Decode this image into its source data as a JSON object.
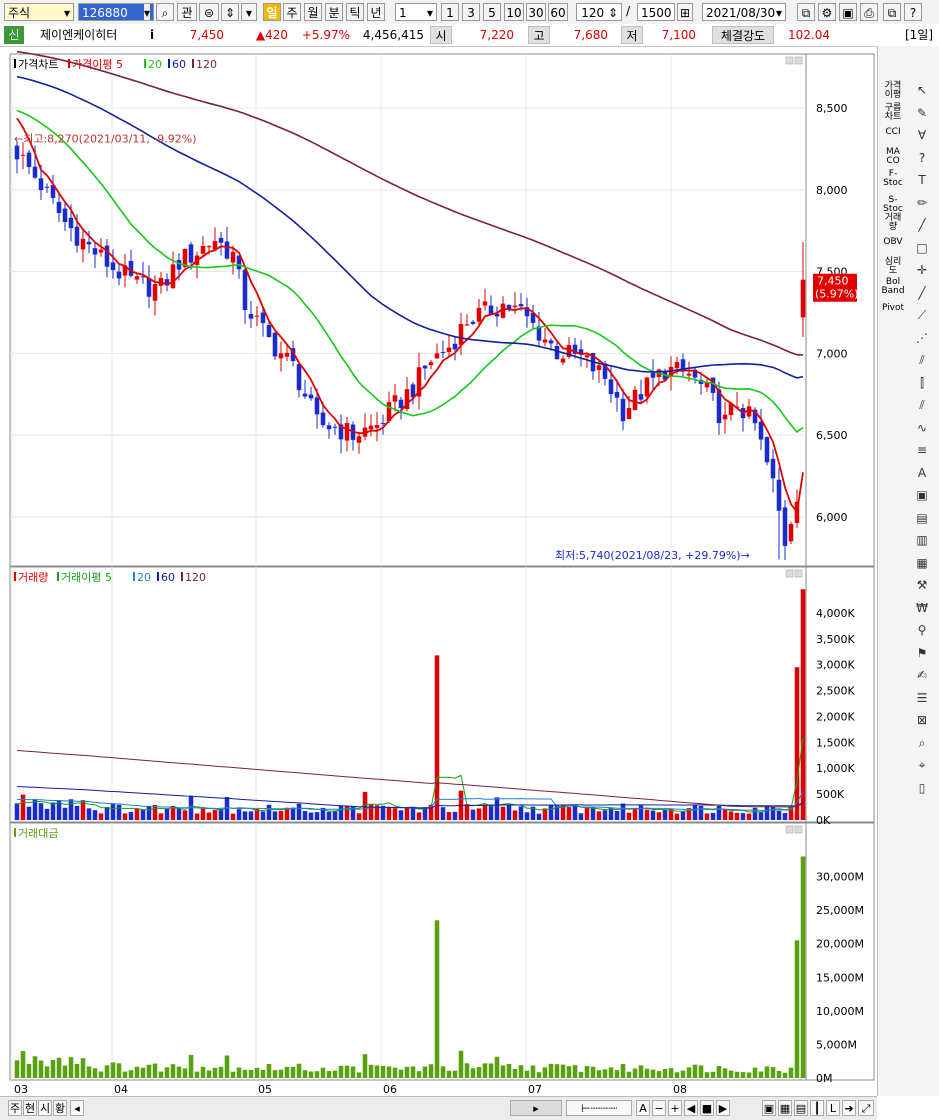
{
  "toolbar": {
    "market": "주식",
    "code": "126880",
    "gwan": "관",
    "periods": [
      "일",
      "주",
      "월",
      "분",
      "틱",
      "년"
    ],
    "minute_value": "1",
    "presets": [
      "1",
      "3",
      "5",
      "10",
      "30",
      "60"
    ],
    "count": "120",
    "slash": "/",
    "total": "1500",
    "date": "2021/08/30"
  },
  "quote": {
    "badge": "신",
    "name": "제이엔케이히터",
    "info": "i",
    "price": "7,450",
    "change": "▲420",
    "change_pct": "+5.97%",
    "volume": "4,456,415",
    "open_label": "시",
    "open": "7,220",
    "high_label": "고",
    "high": "7,680",
    "low_label": "저",
    "low": "7,100",
    "strength_label": "체결강도",
    "strength": "102.04",
    "period_tag": "[1일]"
  },
  "chart_data": [
    {
      "type": "candlestick",
      "legend": [
        {
          "label": "가격차트",
          "color": "#000000"
        },
        {
          "label": "가격이평 5",
          "color": "#e00000"
        },
        {
          "label": "20",
          "color": "#18c818"
        },
        {
          "label": "60",
          "color": "#1020a0"
        },
        {
          "label": "120",
          "color": "#7a1f45"
        }
      ],
      "y_ticks": [
        "8,500",
        "8,000",
        "7,500",
        "7,000",
        "6,500",
        "6,000"
      ],
      "ylim": [
        5700,
        8830
      ],
      "x_ticks": [
        "03",
        "04",
        "05",
        "06",
        "07",
        "08"
      ],
      "current_label": "7,450",
      "current_pct": "(5.97%)",
      "max_annotation": "←최고:8,270(2021/03/11, -9.92%)",
      "min_annotation": "최저:5,740(2021/08/23, +29.79%)→",
      "high": 8270,
      "low": 5740,
      "close": 7450,
      "up_color": "#e00000",
      "down_color": "#1a2bcc"
    },
    {
      "type": "bar",
      "legend": [
        {
          "label": "거래량",
          "color": "#e00000"
        },
        {
          "label": "거래이평 5",
          "color": "#18a018"
        },
        {
          "label": "20",
          "color": "#2080d0"
        },
        {
          "label": "60",
          "color": "#1020a0"
        },
        {
          "label": "120",
          "color": "#7a1f45"
        }
      ],
      "y_ticks": [
        "4,000K",
        "3,500K",
        "3,000K",
        "2,500K",
        "2,000K",
        "1,500K",
        "1,000K",
        "500K",
        "0K"
      ],
      "ylim": [
        0,
        4500000
      ],
      "spikes": [
        {
          "date": "06",
          "value": 3180000
        },
        {
          "date": "2021/08/27",
          "value": 2950000
        },
        {
          "date": "2021/08/30",
          "value": 4456415
        }
      ]
    },
    {
      "type": "bar",
      "legend": [
        {
          "label": "거래대금",
          "color": "#5aa010"
        }
      ],
      "y_ticks": [
        "30,000M",
        "25,000M",
        "20,000M",
        "15,000M",
        "10,000M",
        "5,000M",
        "0M"
      ],
      "ylim": [
        0,
        35000
      ],
      "spikes": [
        {
          "date": "06",
          "value": 23500
        },
        {
          "date": "2021/08/27",
          "value": 20500
        },
        {
          "date": "2021/08/30",
          "value": 33000
        }
      ]
    }
  ],
  "right_panel": {
    "indicators": [
      "가격\n이평",
      "구름\n차트",
      "CCI",
      "MA\nCO",
      "F-\nStoc",
      "S-\nStoc",
      "거래\n량",
      "OBV",
      "심리\n도",
      "Bol\nBand",
      "Pivot"
    ]
  },
  "bottom": {
    "tabs": [
      "주",
      "현",
      "시",
      "황"
    ],
    "controls": [
      "A",
      "−",
      "+",
      "◀",
      "■",
      "▶"
    ]
  }
}
